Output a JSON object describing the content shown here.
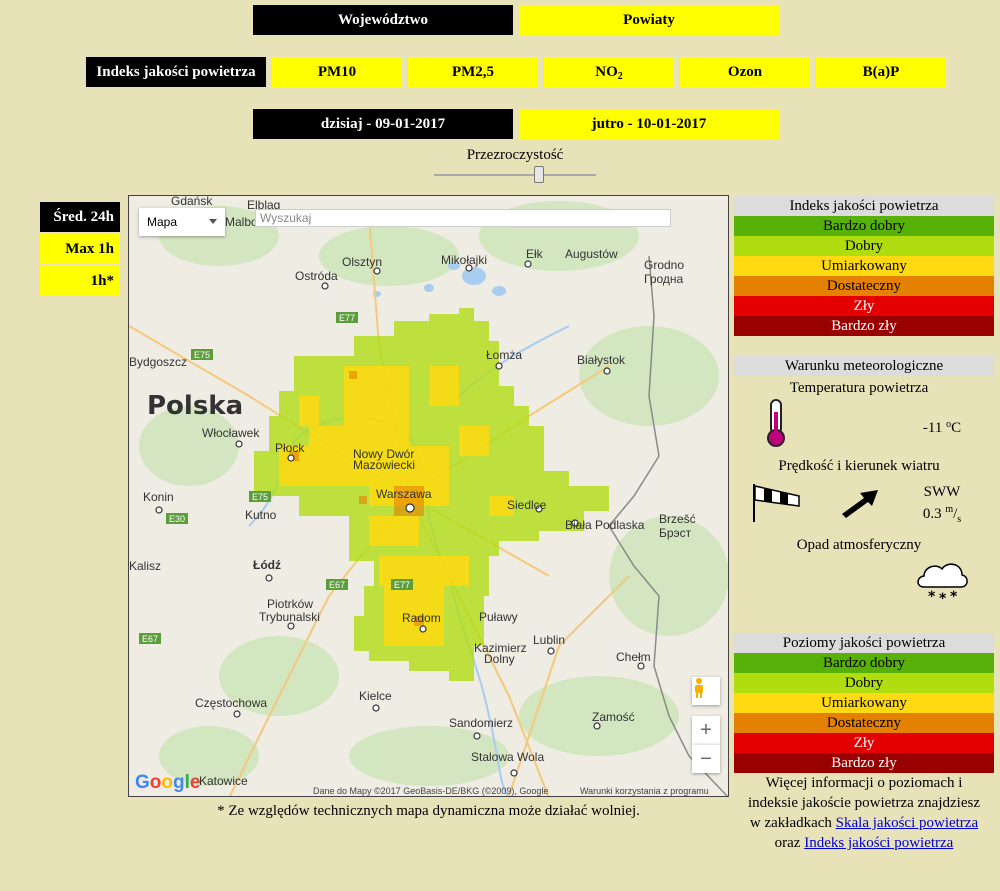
{
  "region_tabs": {
    "voivodeship": "Województwo",
    "districts": "Powiaty"
  },
  "pollutant_tabs": {
    "index": "Indeks jakości powietrza",
    "pm10": "PM10",
    "pm25": "PM2,5",
    "no2_base": "NO",
    "no2_sub": "2",
    "ozone": "Ozon",
    "bap": "B(a)P"
  },
  "day_tabs": {
    "today": "dzisiaj - 09-01-2017",
    "tomorrow": "jutro - 10-01-2017"
  },
  "transparency": {
    "label": "Przezroczystość",
    "value": 0.65
  },
  "period_buttons": {
    "avg24": "Śred. 24h",
    "max1": "Max 1h",
    "h1": "1h*"
  },
  "map": {
    "type_label": "Mapa",
    "search_placeholder": "Wyszukaj",
    "country_label": "Polska",
    "google": "Google",
    "attribution": "Dane do Mapy ©2017 GeoBasis-DE/BKG (©2009), Google",
    "terms": "Warunki korzystania z programu",
    "zoom_in": "+",
    "zoom_out": "−",
    "cities": {
      "gdansk": "Gdańsk",
      "elblag": "Elbląg",
      "malbork": "Malbork",
      "olsztyn": "Olsztyn",
      "mikolajki": "Mikołajki",
      "elk": "Ełk",
      "augustow": "Augustów",
      "grodno": "Grodno",
      "grodno2": "Гродна",
      "ostroda": "Ostróda",
      "bydgoszcz": "Bydgoszcz",
      "lomza": "Łomża",
      "bialystok": "Białystok",
      "wloclawek": "Włocławek",
      "plock": "Płock",
      "ndm1": "Nowy Dwór",
      "ndm2": "Mazowiecki",
      "konin": "Konin",
      "warszawa": "Warszawa",
      "siedlce": "Siedlce",
      "biala": "Biała",
      "podlaska": "Podlaska",
      "brzesc": "Brzešć",
      "brest": "Брэст",
      "kutno": "Kutno",
      "kalisz": "Kalisz",
      "lodz": "Łódź",
      "piotrkow1": "Piotrków",
      "piotrkow2": "Trybunalski",
      "radom": "Radom",
      "pulawy": "Puławy",
      "lublin": "Lublin",
      "kazimierz1": "Kazimierz",
      "kazimierz2": "Dolny",
      "chelm": "Chełm",
      "czestochowa": "Częstochowa",
      "kielce": "Kielce",
      "zamosc": "Zamość",
      "sandomierz": "Sandomierz",
      "stalowa": "Stalowa Wola",
      "katowice": "Katowice"
    },
    "roads": {
      "e77": "E77",
      "e75": "E75",
      "e30": "E30",
      "e67": "E67"
    }
  },
  "footnote": "* Ze względów technicznych mapa dynamiczna może działać wolniej.",
  "aqi_index": {
    "title": "Indeks jakości powietrza",
    "levels": [
      "Bardzo dobry",
      "Dobry",
      "Umiarkowany",
      "Dostateczny",
      "Zły",
      "Bardzo zły"
    ]
  },
  "meteo": {
    "title": "Warunku meteorologiczne",
    "temp_label": "Temperatura powietrza",
    "temp_value": "-11",
    "temp_unit_sup": "o",
    "temp_unit": "C",
    "wind_label": "Prędkość i kierunek wiatru",
    "wind_dir": "SWW",
    "wind_speed": "0.3",
    "wind_unit_num": "m",
    "wind_unit_den": "s",
    "precip_label": "Opad atmosferyczny",
    "precip_icon": "snow-cloud-icon"
  },
  "aq_levels": {
    "title": "Poziomy jakości powietrza",
    "levels": [
      "Bardzo dobry",
      "Dobry",
      "Umiarkowany",
      "Dostateczny",
      "Zły",
      "Bardzo zły"
    ]
  },
  "more_info": {
    "line1": "Więcej informacji o poziomach i",
    "line2": "indeksie jakoście powietrza znajdziesz",
    "line3": "w zakładkach",
    "link1": "Skala jakości powietrza",
    "line4": "oraz",
    "link2": "Indeks jakości powietrza"
  },
  "colors": {
    "level1": "#57b108",
    "level2": "#b0dd10",
    "level3": "#ffd911",
    "level4": "#e58100",
    "level5": "#e50000",
    "level6": "#990000",
    "background": "#e8e2b9",
    "active_tab": "#000000",
    "inactive_tab": "#ffff00"
  }
}
